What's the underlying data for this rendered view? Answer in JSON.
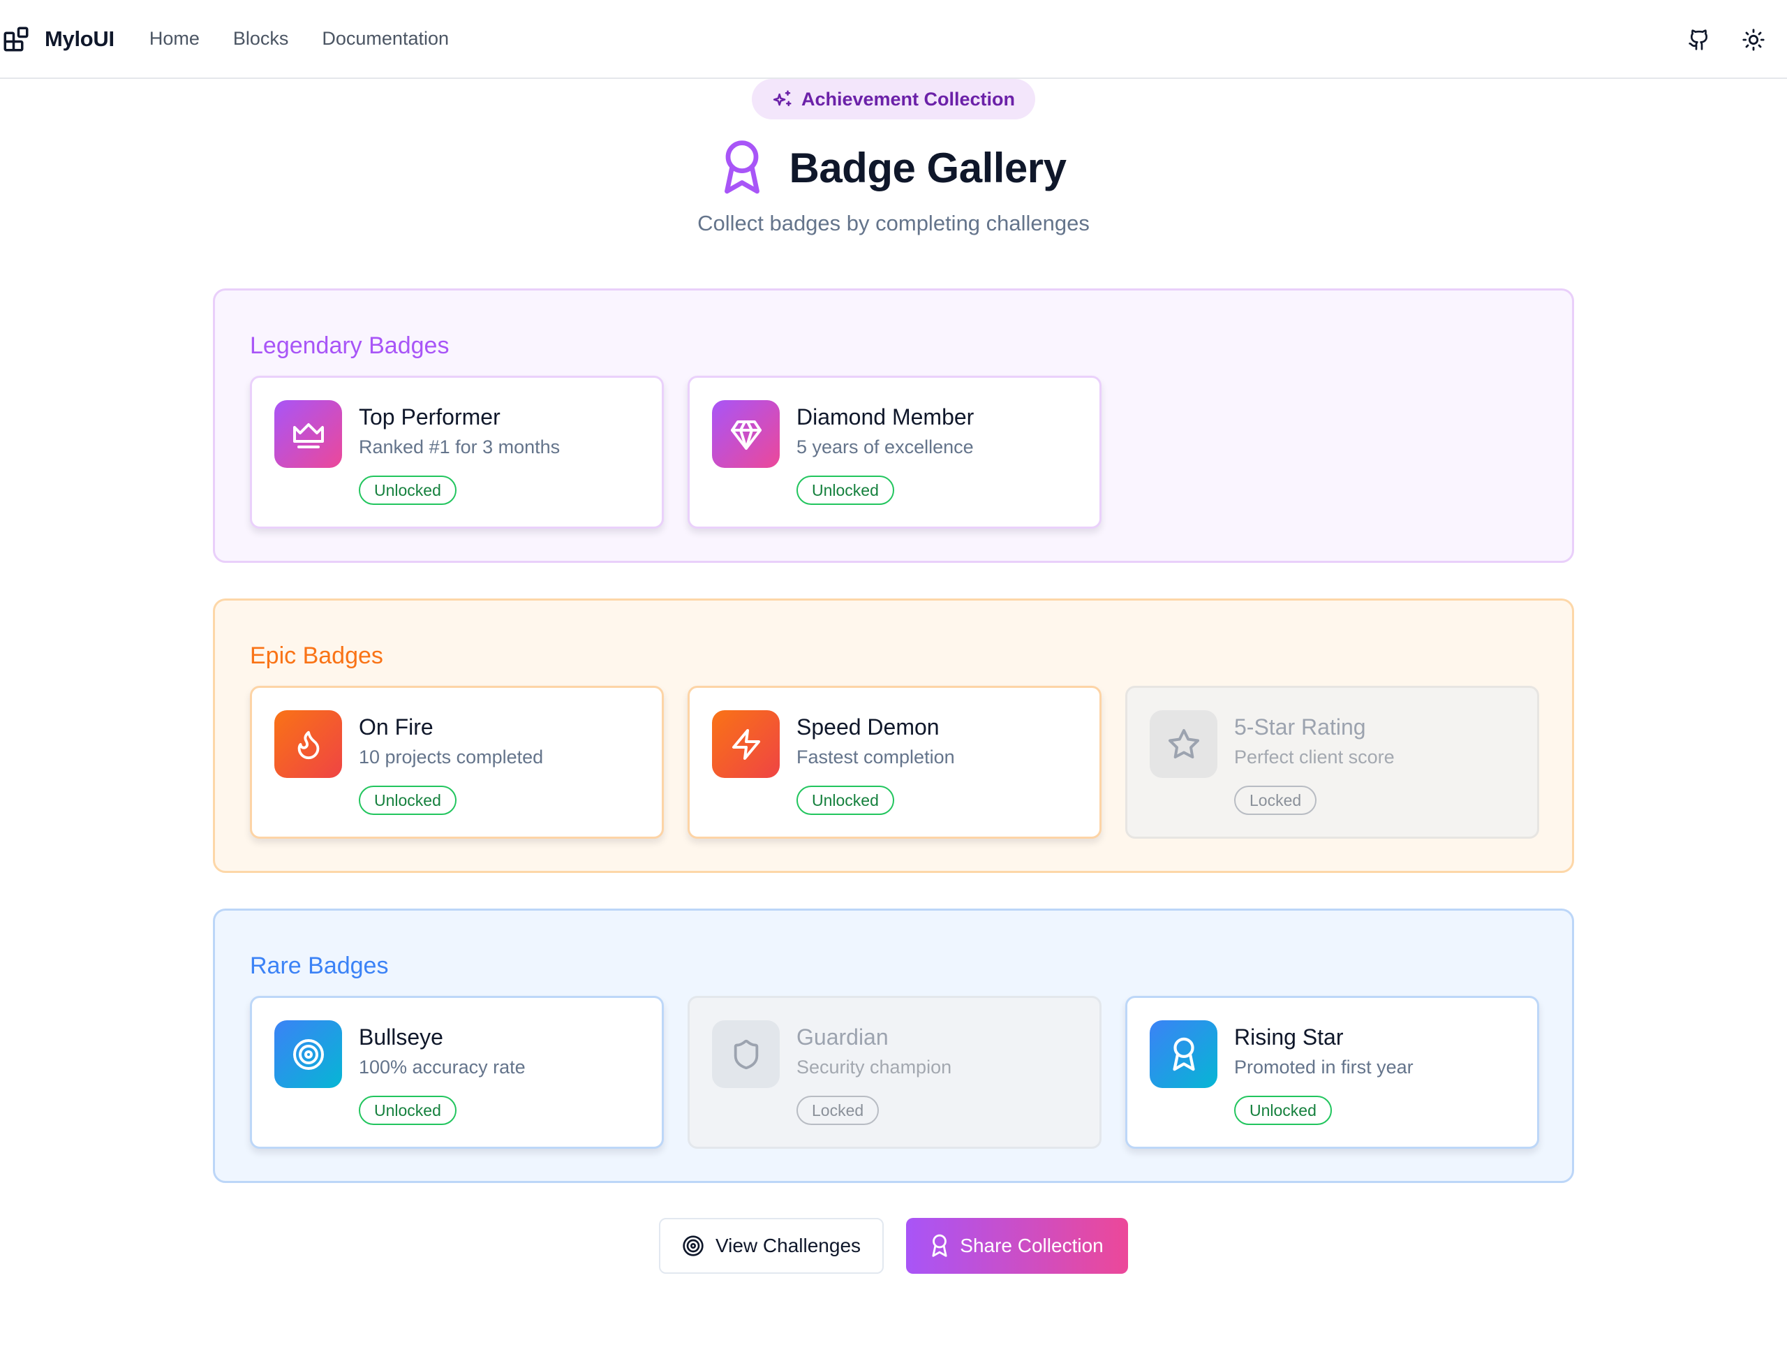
{
  "nav": {
    "brand": "MyloUI",
    "links": [
      "Home",
      "Blocks",
      "Documentation"
    ]
  },
  "hero": {
    "eyebrow": "Achievement Collection",
    "title": "Badge Gallery",
    "subtitle": "Collect badges by completing challenges"
  },
  "tiers": {
    "legendary": {
      "title": "Legendary Badges",
      "badges": [
        {
          "title": "Top Performer",
          "desc": "Ranked #1 for 3 months",
          "status": "Unlocked",
          "icon": "crown-icon"
        },
        {
          "title": "Diamond Member",
          "desc": "5 years of excellence",
          "status": "Unlocked",
          "icon": "diamond-icon"
        }
      ]
    },
    "epic": {
      "title": "Epic Badges",
      "badges": [
        {
          "title": "On Fire",
          "desc": "10 projects completed",
          "status": "Unlocked",
          "icon": "flame-icon"
        },
        {
          "title": "Speed Demon",
          "desc": "Fastest completion",
          "status": "Unlocked",
          "icon": "lightning-icon"
        },
        {
          "title": "5-Star Rating",
          "desc": "Perfect client score",
          "status": "Locked",
          "icon": "star-icon"
        }
      ]
    },
    "rare": {
      "title": "Rare Badges",
      "badges": [
        {
          "title": "Bullseye",
          "desc": "100% accuracy rate",
          "status": "Unlocked",
          "icon": "target-icon"
        },
        {
          "title": "Guardian",
          "desc": "Security champion",
          "status": "Locked",
          "icon": "shield-icon"
        },
        {
          "title": "Rising Star",
          "desc": "Promoted in first year",
          "status": "Unlocked",
          "icon": "award-icon"
        }
      ]
    }
  },
  "actions": {
    "view": "View Challenges",
    "share": "Share Collection"
  },
  "colors": {
    "legendary": "#a855f7",
    "epic": "#f97316",
    "rare": "#3b82f6",
    "unlocked": "#22c55e"
  }
}
